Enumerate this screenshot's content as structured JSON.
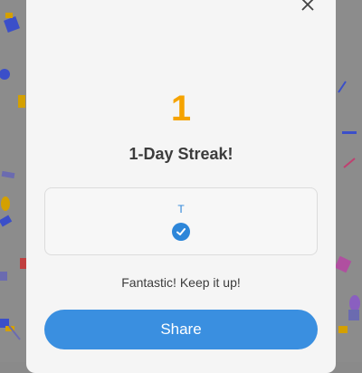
{
  "streak": {
    "count": "1",
    "title": "1-Day Streak!"
  },
  "week": {
    "day_letter": "T",
    "day_completed": true
  },
  "message": "Fantastic! Keep it up!",
  "share_label": "Share",
  "icons": {
    "close": "close-icon",
    "check": "checkmark-icon"
  },
  "colors": {
    "streak_orange": "#f5a300",
    "accent_blue": "#3a8fe0",
    "modal_bg": "#f5f5f5",
    "backdrop": "#8c8c8c"
  }
}
